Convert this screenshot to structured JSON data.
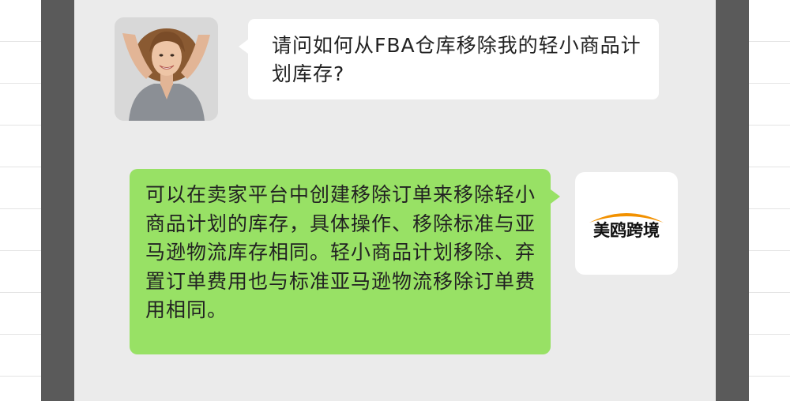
{
  "conversation": {
    "user_message": "请问如何从FBA仓库移除我的轻小商品计划库存?",
    "reply_message": "可以在卖家平台中创建移除订单来移除轻小商品计划的库存，具体操作、移除标准与亚马逊物流库存相同。轻小商品计划移除、弃置订单费用也与标准亚马逊物流移除订单费用相同。",
    "brand_name": "美鸥跨境"
  },
  "colors": {
    "frame": "#5a5a5a",
    "panel": "#ebebeb",
    "reply_bubble": "#98e165",
    "user_bubble": "#ffffff",
    "brand_arc": "#f29100"
  },
  "icons": {
    "user_avatar": "woman-portrait-avatar",
    "brand_avatar": "meiou-kuajing-logo"
  }
}
